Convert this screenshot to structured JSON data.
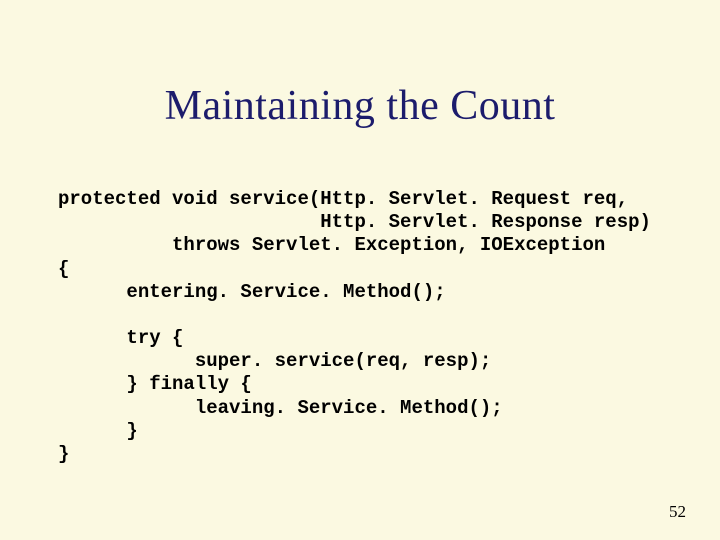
{
  "title": "Maintaining the Count",
  "code_lines": {
    "l0": "protected void service(Http. Servlet. Request req,",
    "l1": "                       Http. Servlet. Response resp)",
    "l2": "          throws Servlet. Exception, IOException",
    "l3": "{",
    "l4": "      entering. Service. Method();",
    "l5": "",
    "l6": "      try {",
    "l7": "            super. service(req, resp);",
    "l8": "      } finally {",
    "l9": "            leaving. Service. Method();",
    "l10": "      }",
    "l11": "}"
  },
  "page_number": "52"
}
